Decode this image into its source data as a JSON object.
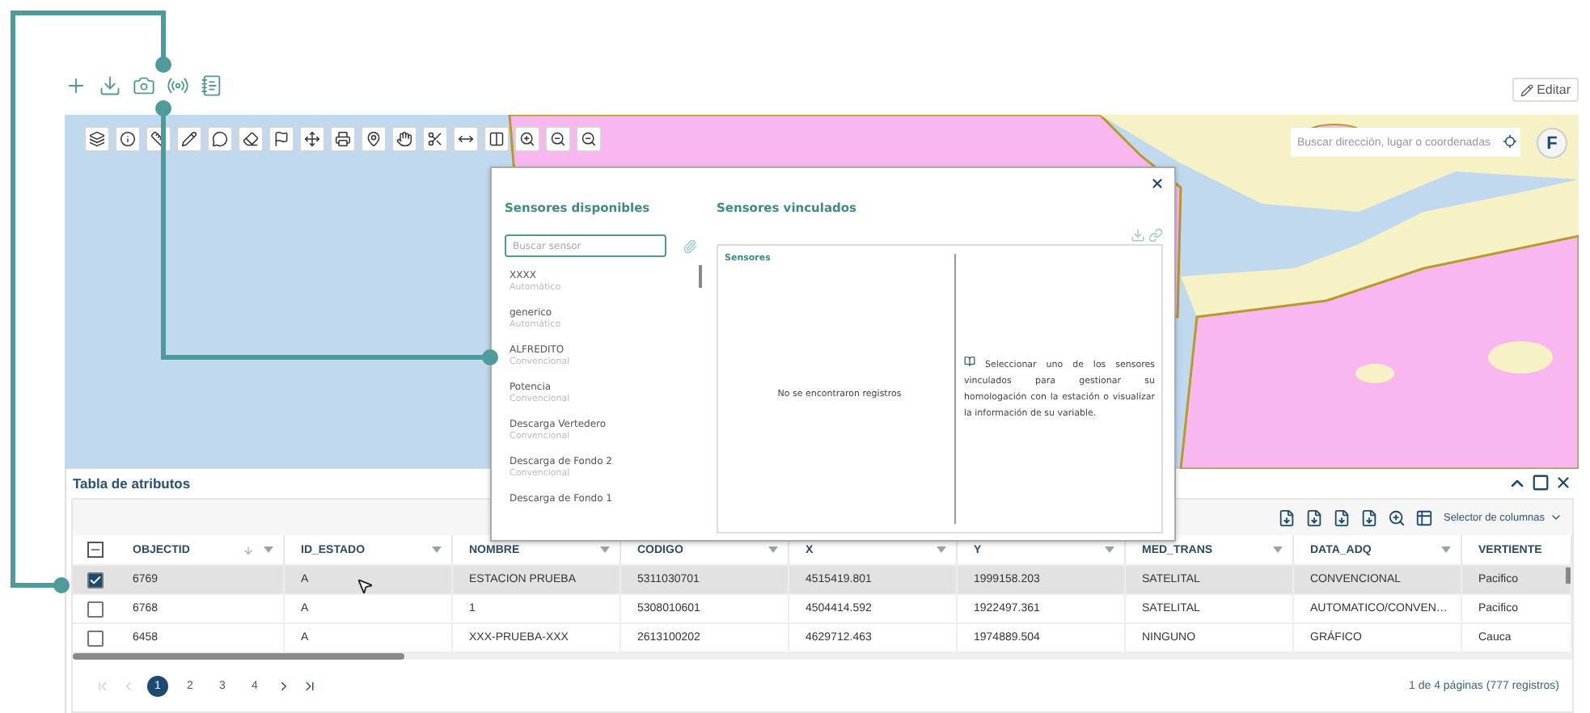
{
  "top_toolbar": {
    "edit_button": "Editar"
  },
  "map": {
    "search": {
      "placeholder": "Buscar dirección, lugar o coordenadas"
    },
    "user_avatar": "F"
  },
  "sensor_dialog": {
    "available_title": "Sensores disponibles",
    "linked_title": "Sensores vinculados",
    "search": {
      "placeholder": "Buscar sensor"
    },
    "available_sensors": [
      {
        "name": "XXXX",
        "type": "Automático"
      },
      {
        "name": "generico",
        "type": "Automático"
      },
      {
        "name": "ALFREDITO",
        "type": "Convencional"
      },
      {
        "name": "Potencia",
        "type": "Convencional"
      },
      {
        "name": "Descarga Vertedero",
        "type": "Convencional"
      },
      {
        "name": "Descarga de Fondo 2",
        "type": "Convencional"
      },
      {
        "name": "Descarga de Fondo 1"
      }
    ],
    "linked_panel": {
      "heading": "Sensores",
      "empty_message": "No se encontraron registros",
      "hint": "Seleccionar uno de los sensores vinculados para gestionar su homologación con la estación o visualizar la información de su variable."
    }
  },
  "attribute_table": {
    "title": "Tabla de atributos",
    "column_selector": "Selector de columnas",
    "select_all_indeterminate": true,
    "columns": [
      {
        "label": "OBJECTID",
        "sorted": true,
        "filter": true
      },
      {
        "label": "ID_ESTADO",
        "filter": true
      },
      {
        "label": "NOMBRE",
        "filter": true
      },
      {
        "label": "CODIGO",
        "filter": true
      },
      {
        "label": "X",
        "filter": true
      },
      {
        "label": "Y",
        "filter": true
      },
      {
        "label": "MED_TRANS",
        "filter": true
      },
      {
        "label": "DATA_ADQ",
        "filter": true
      },
      {
        "label": "VERTIENTE",
        "filter": false
      }
    ],
    "rows": [
      {
        "checked": true,
        "selected": true,
        "cells": [
          "6769",
          "A",
          "ESTACION PRUEBA",
          "5311030701",
          "4515419.801",
          "1999158.203",
          "SATELITAL",
          "CONVENCIONAL",
          "Pacifico"
        ]
      },
      {
        "checked": false,
        "selected": false,
        "cells": [
          "6768",
          "A",
          "1",
          "5308010601",
          "4504414.592",
          "1922497.361",
          "SATELITAL",
          "AUTOMATICO/CONVEN…",
          "Pacifico"
        ]
      },
      {
        "checked": false,
        "selected": false,
        "cells": [
          "6458",
          "A",
          "XXX-PRUEBA-XXX",
          "2613100202",
          "4629712.463",
          "1974889.504",
          "NINGUNO",
          "GRÁFICO",
          "Cauca"
        ]
      }
    ],
    "pagination": {
      "nav": [
        {
          "kind": "first",
          "disabled": true
        },
        {
          "kind": "prev",
          "disabled": true
        },
        {
          "kind": "next",
          "disabled": false
        },
        {
          "kind": "last",
          "disabled": false
        }
      ],
      "pages": [
        {
          "label": "1",
          "selected": true
        },
        {
          "label": "2",
          "selected": false
        },
        {
          "label": "3",
          "selected": false
        },
        {
          "label": "4",
          "selected": false
        }
      ],
      "summary": "1 de 4 páginas (777 registros)"
    }
  }
}
